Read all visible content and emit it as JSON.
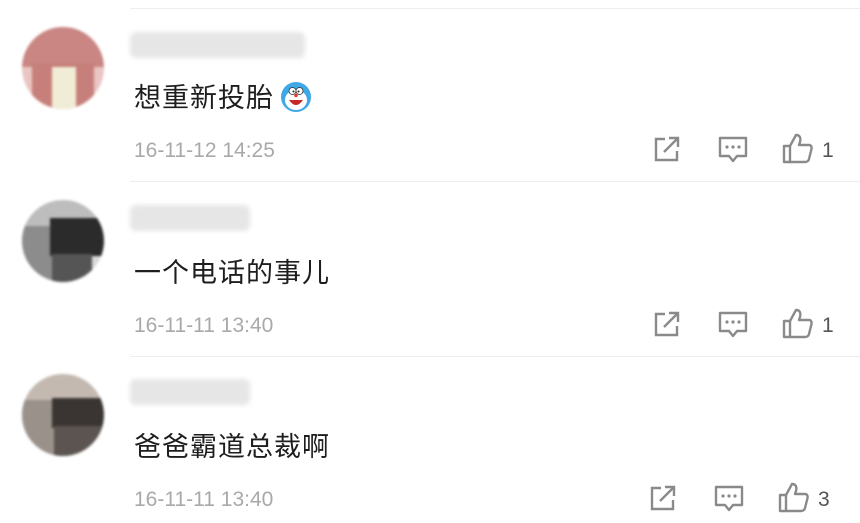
{
  "comments": [
    {
      "text": "想重新投胎",
      "time": "16-11-12 14:25",
      "likes": "1",
      "emoji": "doraemon-emoji"
    },
    {
      "text": "一个电话的事儿",
      "time": "16-11-11 13:40",
      "likes": "1"
    },
    {
      "text": "爸爸霸道总裁啊",
      "time": "16-11-11 13:40",
      "likes": "3"
    }
  ],
  "icons": {
    "share": "share-icon",
    "reply": "comment-icon",
    "like": "thumbs-up-icon"
  },
  "colors": {
    "text": "#1e1e1e",
    "meta": "#a9a9a9",
    "icon": "#8a8a8a",
    "divider": "#eeeeee"
  }
}
